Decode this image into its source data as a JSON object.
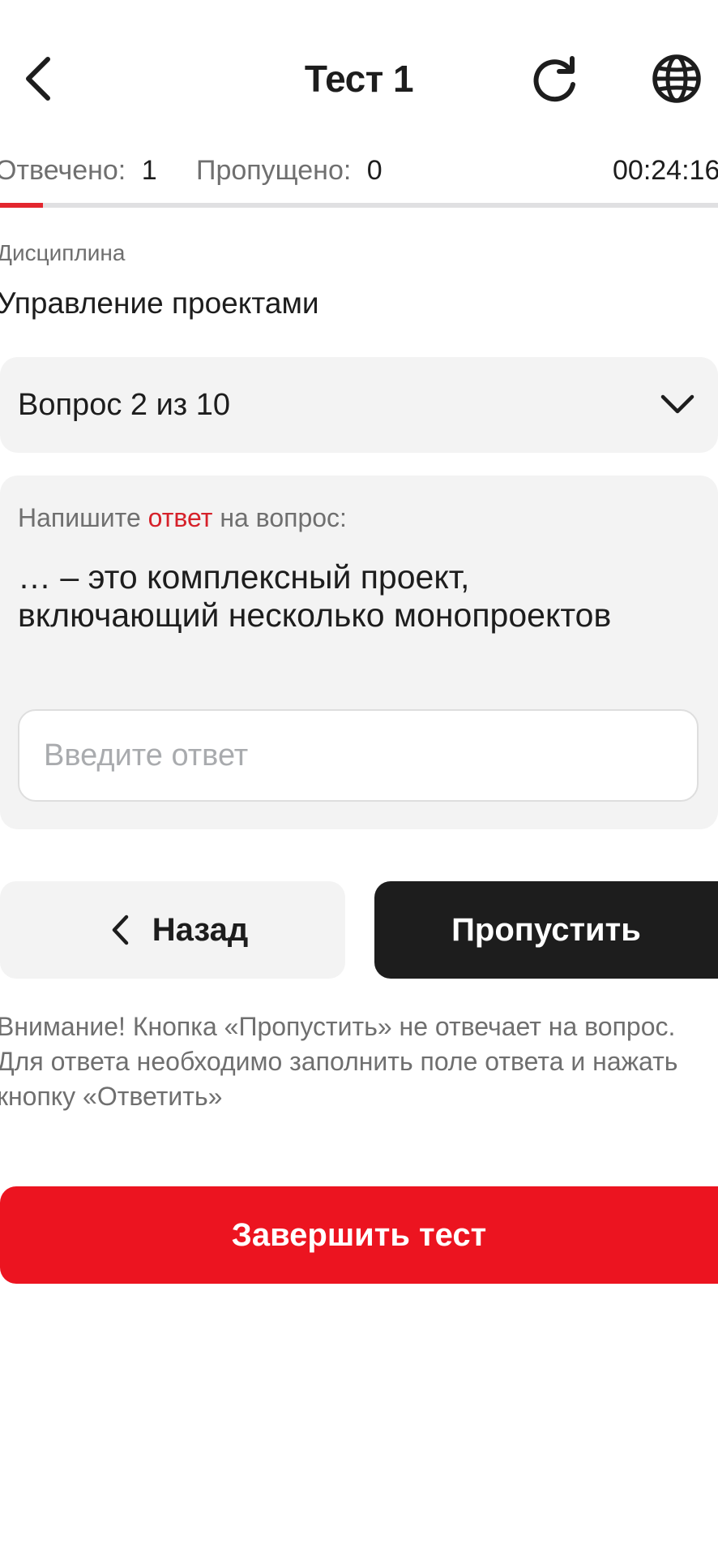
{
  "header": {
    "title": "Тест 1",
    "back_icon": "chevron-left-icon",
    "refresh_icon": "refresh-icon",
    "language_icon": "globe-icon"
  },
  "stats": {
    "answered_label": "Отвечено:",
    "answered_value": "1",
    "skipped_label": "Пропущено:",
    "skipped_value": "0",
    "timer": "00:24:16"
  },
  "progress": {
    "fraction": 0.06,
    "fill_color": "#e3262e",
    "track_color": "#e0e0e2"
  },
  "discipline": {
    "label": "Дисциплина",
    "value": "Управление проектами"
  },
  "question_selector": {
    "label": "Вопрос 2 из 10",
    "icon": "chevron-down-icon"
  },
  "question": {
    "prompt_before": "Напишите ",
    "prompt_accent": "ответ",
    "prompt_after": " на вопрос:",
    "text": "… – это комплексный проект, включающий несколько монопроектов",
    "answer_placeholder": "Введите ответ",
    "answer_value": ""
  },
  "buttons": {
    "back_label": "Назад",
    "skip_label": "Пропустить",
    "finish_label": "Завершить тест"
  },
  "warning": {
    "text": "Внимание! Кнопка «Пропустить» не отвечает на вопрос. Для ответа необходимо заполнить поле ответа и нажать кнопку «Ответить»"
  },
  "colors": {
    "accent_red": "#ec1420",
    "dark_button": "#1d1d1d",
    "card_bg": "#f3f3f3"
  }
}
